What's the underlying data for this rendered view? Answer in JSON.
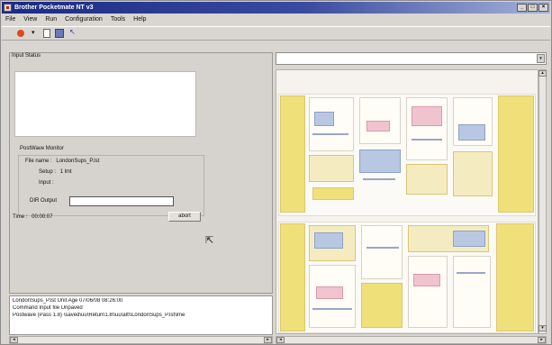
{
  "window": {
    "title": "Brother Pocketmate NT v3",
    "buttons": [
      "_",
      "□",
      "×"
    ]
  },
  "menu": [
    "File",
    "View",
    "Run",
    "Configuration",
    "Tools",
    "Help"
  ],
  "toolbar": {
    "icons": [
      "run-icon",
      "dropdown-icon",
      "document-icon",
      "save-icon",
      "help-pointer-icon"
    ]
  },
  "left_pane": {
    "title": "Input Status",
    "group_title": "PostWave Monitor",
    "file_name_label": "File name :",
    "file_name_value": "LondonSups_P.lst",
    "setup_label": "Setup :",
    "setup_value": "1 lmt",
    "input_label": "Input :",
    "input_value": "",
    "dir_output_label": "DIR Output",
    "dir_output_value": "",
    "time_label": "Time :",
    "time_value": "00:00:07",
    "abort_label": "abort"
  },
  "log": {
    "lines": [
      "LondonSups_P.lst      Unit Age 07/06/08 08:26:00",
      "Command Input file Unpaved",
      "Postwave (Pass 1.8) \\saved\\uu\\Return1.8\\\\uu\\alt\\\\LondonSups_P.lst\\lme"
    ]
  },
  "address_bar": {
    "value": ""
  },
  "scroll_glyphs": {
    "left": "◂",
    "right": "▸",
    "up": "▴",
    "down": "▾"
  },
  "cursor_glyph": "⇱"
}
